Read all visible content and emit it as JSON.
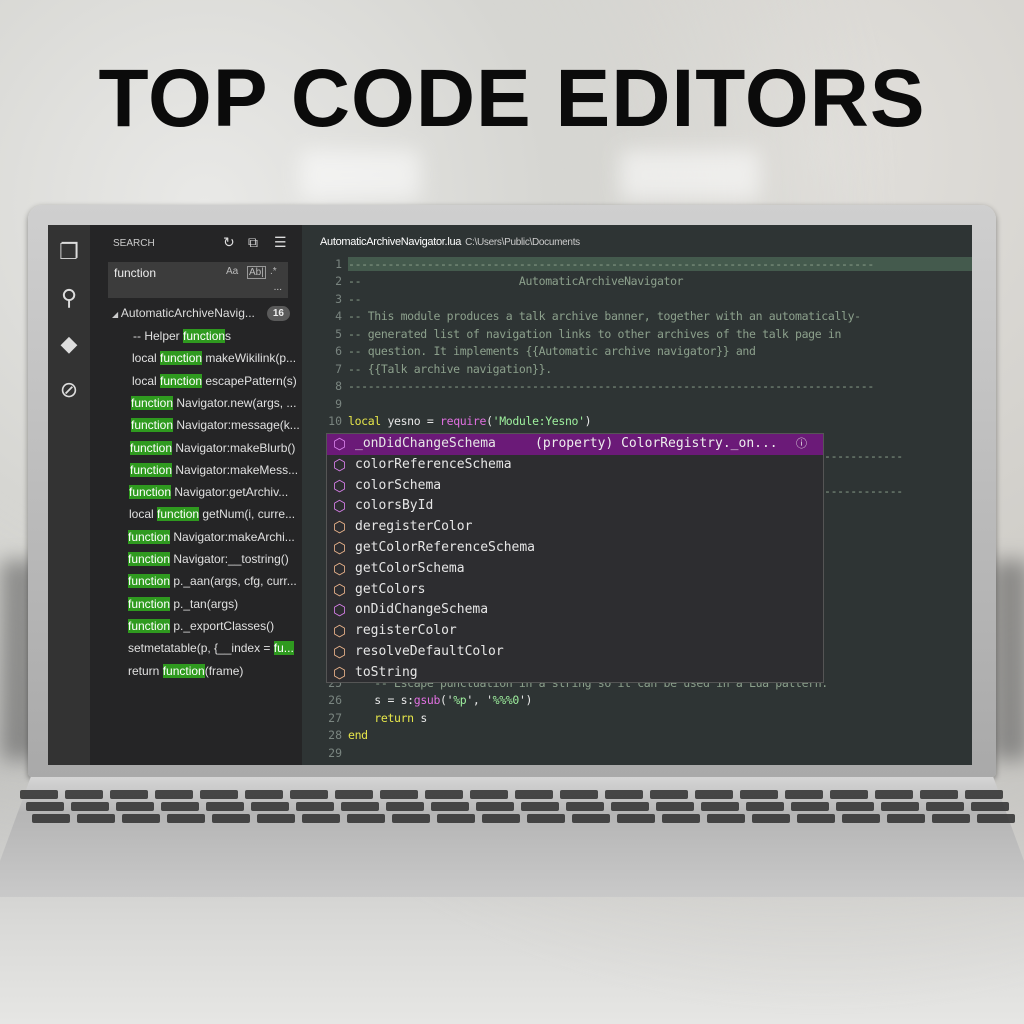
{
  "headline": "TOP CODE EDITORS",
  "activity_bar": {
    "items": [
      {
        "icon": "explorer-icon"
      },
      {
        "icon": "search-icon"
      },
      {
        "icon": "git-icon"
      },
      {
        "icon": "debug-icon"
      }
    ]
  },
  "sidebar": {
    "title": "SEARCH",
    "search_value": "function",
    "options": {
      "match_case": "Aa",
      "whole_word": "Ab|",
      "regex": ".*",
      "more": "..."
    },
    "file": {
      "name": "AutomaticArchiveNavig...",
      "count": "16"
    },
    "results": [
      {
        "pre": "-- Helper ",
        "match": "function",
        "post": "s"
      },
      {
        "pre": "local ",
        "match": "function",
        "post": " makeWikilink(p..."
      },
      {
        "pre": "local ",
        "match": "function",
        "post": " escapePattern(s)"
      },
      {
        "pre": "",
        "match": "function",
        "post": " Navigator.new(args, ..."
      },
      {
        "pre": "",
        "match": "function",
        "post": " Navigator:message(k..."
      },
      {
        "pre": "",
        "match": "function",
        "post": " Navigator:makeBlurb()"
      },
      {
        "pre": "",
        "match": "function",
        "post": " Navigator:makeMess..."
      },
      {
        "pre": "",
        "match": "function",
        "post": " Navigator:getArchiv..."
      },
      {
        "pre": "local ",
        "match": "function",
        "post": " getNum(i, curre..."
      },
      {
        "pre": "",
        "match": "function",
        "post": " Navigator:makeArchi..."
      },
      {
        "pre": "",
        "match": "function",
        "post": " Navigator:__tostring()"
      },
      {
        "pre": "",
        "match": "function",
        "post": " p._aan(args, cfg, curr..."
      },
      {
        "pre": "",
        "match": "function",
        "post": " p._tan(args)"
      },
      {
        "pre": "",
        "match": "function",
        "post": " p._exportClasses()"
      },
      {
        "pre": "setmetatable(p, {__index = ",
        "match": "fu...",
        "post": ""
      },
      {
        "pre": "return ",
        "match": "function",
        "post": "(frame)"
      }
    ]
  },
  "editor": {
    "filename": "AutomaticArchiveNavigator.lua",
    "path": "C:\\Users\\Public\\Documents",
    "lines": [
      {
        "n": "1",
        "text": "--------------------------------------------------------------------------------"
      },
      {
        "n": "2",
        "text": "--                        AutomaticArchiveNavigator"
      },
      {
        "n": "3",
        "text": "--"
      },
      {
        "n": "4",
        "text": "-- This module produces a talk archive banner, together with an automatically-"
      },
      {
        "n": "5",
        "text": "-- generated list of navigation links to other archives of the talk page in"
      },
      {
        "n": "6",
        "text": "-- question. It implements {{Automatic archive navigator}} and"
      },
      {
        "n": "7",
        "text": "-- {{Talk archive navigation}}."
      },
      {
        "n": "8",
        "text": "--------------------------------------------------------------------------------"
      },
      {
        "n": "9",
        "text": ""
      }
    ],
    "line10": {
      "n": "10",
      "kw": "local",
      "id": " yesno = ",
      "fn": "require",
      "p1": "(",
      "str": "'Module:Yesno'",
      "p2": ")"
    },
    "hidden_dashes": "------------",
    "line25": {
      "n": "25",
      "text": "    -- Escape punctuation in a string so it can be used in a Lua pattern."
    },
    "line26": {
      "n": "26",
      "a": "    s = s:",
      "fn": "gsub",
      "b": "('",
      "s1": "%p",
      "c": "', '",
      "s2": "%%%0",
      "d": "')"
    },
    "line27": {
      "n": "27",
      "kw": "    return",
      "id": " s"
    },
    "line28": {
      "n": "28",
      "kw": "end"
    },
    "line29": {
      "n": "29"
    }
  },
  "suggest": {
    "detail": "(property) ColorRegistry._on...",
    "items": [
      {
        "label": "_onDidChangeSchema",
        "kind": "property"
      },
      {
        "label": "colorReferenceSchema",
        "kind": "property"
      },
      {
        "label": "colorSchema",
        "kind": "property"
      },
      {
        "label": "colorsById",
        "kind": "property"
      },
      {
        "label": "deregisterColor",
        "kind": "method"
      },
      {
        "label": "getColorReferenceSchema",
        "kind": "method"
      },
      {
        "label": "getColorSchema",
        "kind": "method"
      },
      {
        "label": "getColors",
        "kind": "method"
      },
      {
        "label": "onDidChangeSchema",
        "kind": "property"
      },
      {
        "label": "registerColor",
        "kind": "method"
      },
      {
        "label": "resolveDefaultColor",
        "kind": "method"
      },
      {
        "label": "toString",
        "kind": "method"
      }
    ],
    "colors": {
      "selected": "#6b1a78",
      "property_icon": "#d67fe8",
      "method_icon": "#e8b28a"
    }
  }
}
